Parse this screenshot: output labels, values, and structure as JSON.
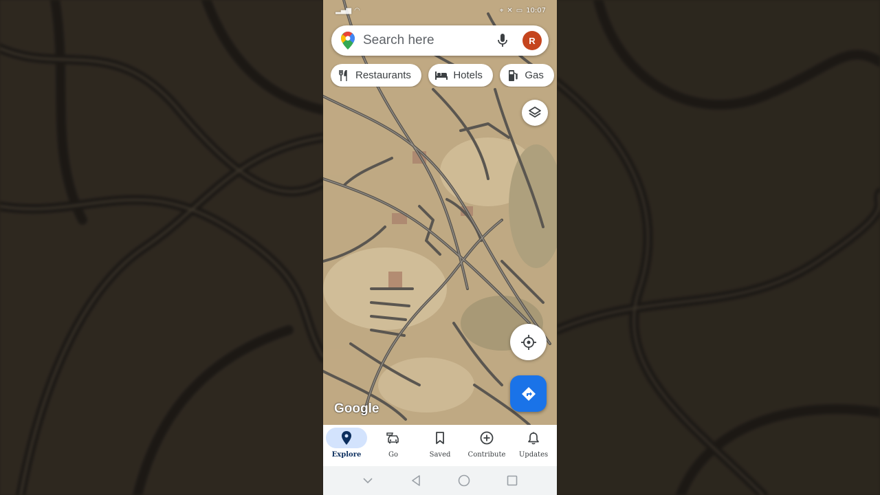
{
  "status_bar": {
    "left_text": "",
    "time": "10:07"
  },
  "search": {
    "placeholder": "Search here",
    "avatar_letter": "R"
  },
  "chips": [
    {
      "label": "Restaurants",
      "icon": "fork-knife-icon"
    },
    {
      "label": "Hotels",
      "icon": "bed-icon"
    },
    {
      "label": "Gas",
      "icon": "gas-pump-icon"
    }
  ],
  "map": {
    "watermark": "Google"
  },
  "bottom_nav": {
    "items": [
      {
        "label": "Explore",
        "icon": "pin-icon",
        "active": true
      },
      {
        "label": "Go",
        "icon": "car-icon",
        "active": false
      },
      {
        "label": "Saved",
        "icon": "bookmark-icon",
        "active": false
      },
      {
        "label": "Contribute",
        "icon": "plus-circle-icon",
        "active": false
      },
      {
        "label": "Updates",
        "icon": "bell-icon",
        "active": false
      }
    ]
  },
  "colors": {
    "accent": "#1a73e8",
    "avatar": "#c5451e",
    "active_nav_pill": "#d3e3fd"
  }
}
